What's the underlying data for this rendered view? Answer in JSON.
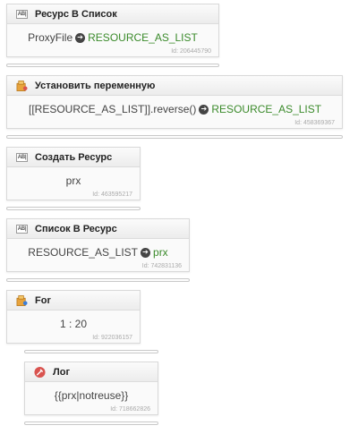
{
  "blocks": [
    {
      "title": "Ресурс В Список",
      "icon": "text-abl-icon",
      "icon_text": "AB|",
      "body_left": "ProxyFile",
      "body_right": "RESOURCE_AS_LIST",
      "id_label": "Id: 206445790"
    },
    {
      "title": "Установить переменную",
      "icon": "variable-icon",
      "body_left": "[[RESOURCE_AS_LIST]].reverse()",
      "body_right": "RESOURCE_AS_LIST",
      "id_label": "Id: 458369367"
    },
    {
      "title": "Создать Ресурс",
      "icon": "text-abl-icon",
      "icon_text": "AB|",
      "body": "prx",
      "id_label": "Id: 463595217"
    },
    {
      "title": "Список В Ресурс",
      "icon": "text-abl-icon",
      "icon_text": "AB|",
      "body_left": "RESOURCE_AS_LIST",
      "body_right": "prx",
      "id_label": "Id: 742831136"
    },
    {
      "title": "For",
      "icon": "loop-icon",
      "body": "1 : 20",
      "id_label": "Id: 922036157"
    },
    {
      "title": "Лог",
      "icon": "log-icon",
      "body": "{{prx|notreuse}}",
      "id_label": "Id: 718662826"
    }
  ],
  "colors": {
    "accent_green": "#3a8a2a",
    "log_icon": "#d9534f"
  }
}
